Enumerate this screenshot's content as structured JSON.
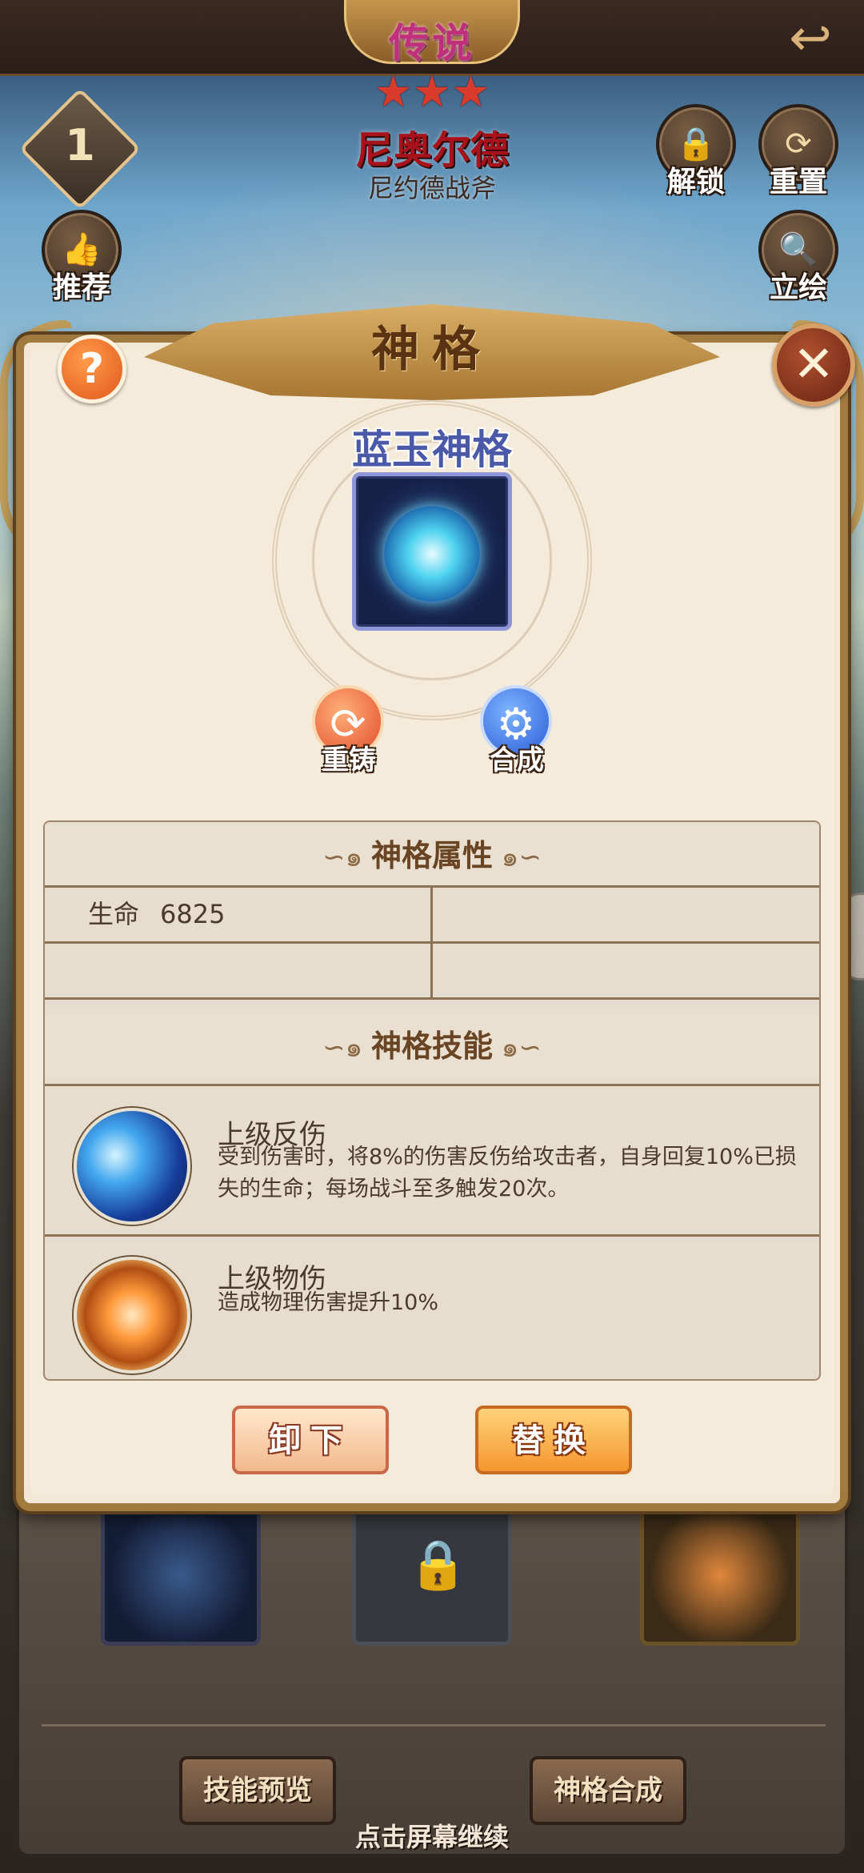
{
  "header": {
    "rarity": "传说",
    "stars": [
      "★",
      "★",
      "★"
    ],
    "hero_name": "尼奥尔德",
    "hero_subtitle": "尼约德战斧",
    "level": "1",
    "back_icon": "back-arrow-icon"
  },
  "side_buttons": {
    "unlock": "解锁",
    "reset": "重置",
    "recommend": "推荐",
    "portrait": "立绘"
  },
  "modal": {
    "title": "神格",
    "help": "?",
    "close": "✕",
    "godhood_name": "蓝玉神格",
    "reforge": "重铸",
    "fusion": "合成",
    "attributes_header": "神格属性",
    "attributes": [
      {
        "name": "生命",
        "value": "6825"
      }
    ],
    "skills_header": "神格技能",
    "skills": [
      {
        "name": "上级反伤",
        "desc": "受到伤害时，将8%的伤害反伤给攻击者，自身回复10%已损失的生命；每场战斗至多触发20次。"
      },
      {
        "name": "上级物伤",
        "desc": "造成物理伤害提升10%"
      }
    ],
    "unequip": "卸下",
    "replace": "替换"
  },
  "footer": {
    "skill_preview": "技能预览",
    "godhood_fusion": "神格合成",
    "tap_continue": "点击屏幕继续"
  },
  "colors": {
    "modal_bg": "#f5ebdb",
    "title_text": "#5a3412",
    "godhood_name": "#4a5aa8",
    "replace_button": "#f5962e"
  }
}
